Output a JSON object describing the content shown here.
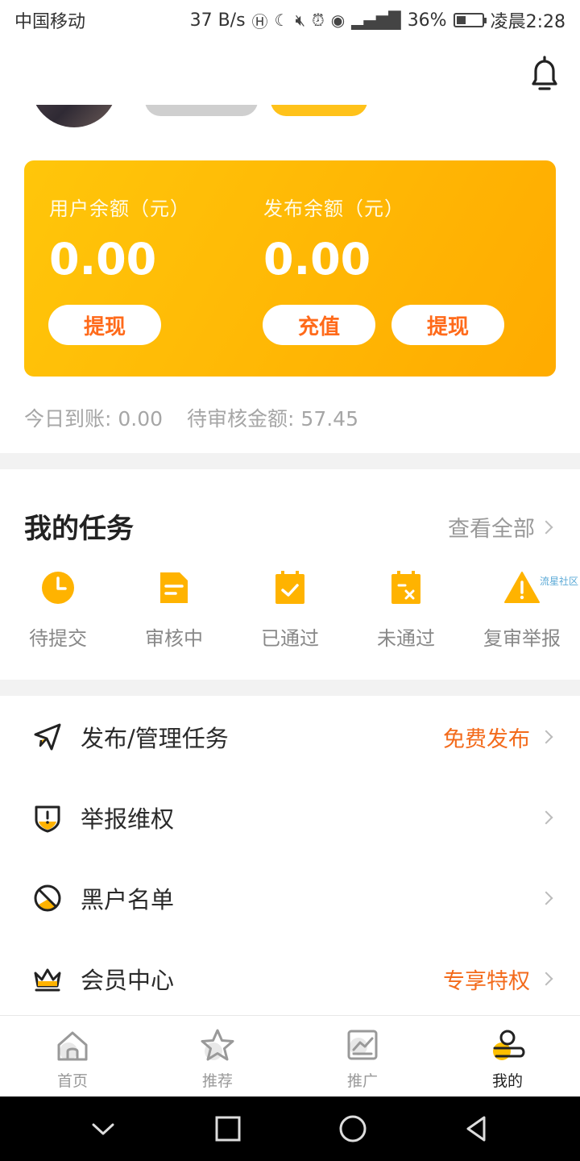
{
  "status_bar": {
    "carrier": "中国移动",
    "speed": "37 B/s",
    "battery_percent": "36%",
    "battery_level": 0.36,
    "time": "凌晨2:28",
    "icons": [
      "hd-icon",
      "moon-icon",
      "mute-icon",
      "alarm-icon",
      "eye-icon",
      "4g-signal-icon",
      "battery-icon"
    ]
  },
  "header": {
    "bell_icon": "bell-icon"
  },
  "balance": {
    "user_label": "用户余额（元）",
    "user_amount": "0.00",
    "publish_label": "发布余额（元）",
    "publish_amount": "0.00",
    "withdraw_label": "提现",
    "recharge_label": "充值",
    "withdraw2_label": "提现"
  },
  "today": {
    "arrived": "今日到账: 0.00",
    "pending": "待审核金额: 57.45"
  },
  "tasks": {
    "title": "我的任务",
    "view_all": "查看全部",
    "watermark": "流星社区",
    "items": [
      {
        "label": "待提交",
        "icon": "clock-icon"
      },
      {
        "label": "审核中",
        "icon": "document-icon"
      },
      {
        "label": "已通过",
        "icon": "check-calendar-icon"
      },
      {
        "label": "未通过",
        "icon": "x-calendar-icon"
      },
      {
        "label": "复审举报",
        "icon": "warning-icon"
      }
    ]
  },
  "menu": [
    {
      "label": "发布/管理任务",
      "extra": "免费发布",
      "icon": "send-icon"
    },
    {
      "label": "举报维权",
      "extra": "",
      "icon": "shield-alert-icon"
    },
    {
      "label": "黑户名单",
      "extra": "",
      "icon": "block-icon"
    },
    {
      "label": "会员中心",
      "extra": "专享特权",
      "icon": "crown-icon"
    }
  ],
  "tabs": [
    {
      "label": "首页",
      "icon": "home-icon"
    },
    {
      "label": "推荐",
      "icon": "star-icon"
    },
    {
      "label": "推广",
      "icon": "chart-icon"
    },
    {
      "label": "我的",
      "icon": "user-icon"
    }
  ],
  "colors": {
    "accent": "#ffb700",
    "highlight_text": "#f36b1c",
    "muted_text": "#999999"
  }
}
